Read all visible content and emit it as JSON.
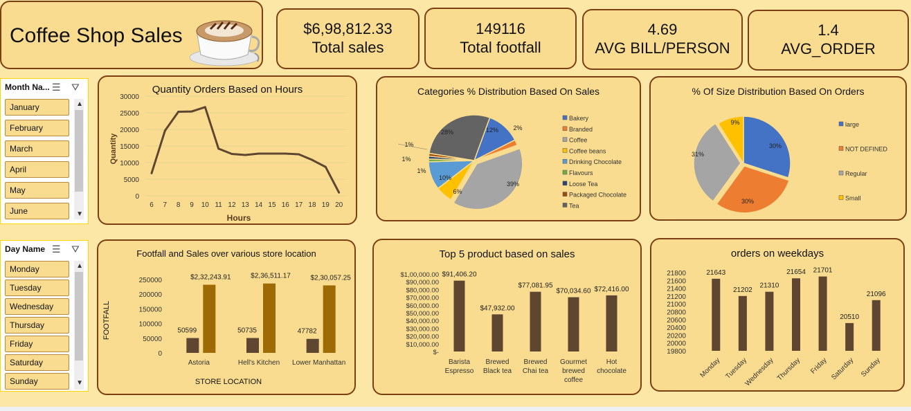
{
  "title": "Coffee Shop Sales",
  "kpis": [
    {
      "value": "$6,98,812.33",
      "label": "Total sales"
    },
    {
      "value": "149116",
      "label": "Total footfall"
    },
    {
      "value": "4.69",
      "label": "AVG BILL/PERSON"
    },
    {
      "value": "1.4",
      "label": "AVG_ORDER"
    }
  ],
  "month_slicer": {
    "header": "Month Na...",
    "items": [
      "January",
      "February",
      "March",
      "April",
      "May",
      "June"
    ]
  },
  "day_slicer": {
    "header": "Day Name",
    "items": [
      "Monday",
      "Tuesday",
      "Wednesday",
      "Thursday",
      "Friday",
      "Saturday",
      "Sunday"
    ]
  },
  "colors": {
    "bar_brown": "#5e4630",
    "bar_gold": "#9e6a05",
    "line": "#5e4630",
    "border": "#7b3f12",
    "card": "#f9dc8f",
    "bg": "#fde7a6"
  },
  "chart_data": [
    {
      "type": "line",
      "title": "Quantity Orders Based on Hours",
      "xlabel": "Hours",
      "ylabel": "Quantity",
      "x": [
        6,
        7,
        8,
        9,
        10,
        11,
        12,
        13,
        14,
        15,
        16,
        17,
        18,
        19,
        20
      ],
      "values": [
        6800,
        19600,
        25300,
        25400,
        26700,
        14200,
        12600,
        12300,
        12700,
        12700,
        12700,
        12500,
        10800,
        8700,
        1000
      ],
      "ylim": [
        0,
        30000
      ],
      "yticks": [
        "0",
        "5000",
        "10000",
        "15000",
        "20000",
        "25000",
        "30000"
      ]
    },
    {
      "type": "pie",
      "title": "Categories % Distribution Based On Sales",
      "labels": [
        "Bakery",
        "Branded",
        "Coffee",
        "Coffee beans",
        "Drinking Chocolate",
        "Flavours",
        "Loose Tea",
        "Packaged Chocolate",
        "Tea"
      ],
      "values": [
        12,
        2,
        39,
        6,
        10,
        1,
        1,
        1,
        28
      ],
      "data_labels": [
        "12%",
        "2%",
        "39%",
        "6%",
        "10%",
        "1%",
        "1%",
        "1%",
        "28%"
      ],
      "colors": [
        "#4472c4",
        "#ed7d31",
        "#a5a5a5",
        "#ffc000",
        "#5b9bd5",
        "#70ad47",
        "#264478",
        "#9e480e",
        "#636363"
      ],
      "legend": "right"
    },
    {
      "type": "pie",
      "title": "% Of Size Distribution Based On Orders",
      "labels": [
        "large",
        "NOT DEFINED",
        "Regular",
        "Small"
      ],
      "values": [
        30,
        30,
        31,
        9
      ],
      "data_labels": [
        "30%",
        "30%",
        "31%",
        "9%"
      ],
      "colors": [
        "#4472c4",
        "#ed7d31",
        "#a5a5a5",
        "#ffc000"
      ],
      "legend": "right"
    },
    {
      "type": "bar",
      "title": "Footfall and Sales over various store location",
      "xlabel": "STORE LOCATION",
      "ylabel": "FOOTFALL",
      "categories": [
        "Astoria",
        "Hell's Kitchen",
        "Lower Manhattan"
      ],
      "series": [
        {
          "values": [
            50599,
            50735,
            47782
          ],
          "labels": [
            "50599",
            "50735",
            "47782"
          ]
        },
        {
          "values": [
            232243.91,
            236511.17,
            230057.25
          ],
          "labels": [
            "$2,32,243.91",
            "$2,36,511.17",
            "$2,30,057.25"
          ]
        }
      ],
      "ylim": [
        0,
        250000
      ],
      "yticks": [
        "0",
        "50000",
        "100000",
        "150000",
        "200000",
        "250000"
      ]
    },
    {
      "type": "bar",
      "title": "Top 5 product based on sales",
      "categories": [
        [
          "Barista",
          "Espresso"
        ],
        [
          "Brewed",
          "Black tea"
        ],
        [
          "Brewed",
          "Chai tea"
        ],
        [
          "Gourmet",
          "brewed",
          "coffee"
        ],
        [
          "Hot",
          "chocolate"
        ]
      ],
      "values": [
        91406.2,
        47932.0,
        77081.95,
        70034.6,
        72416.0
      ],
      "data_labels": [
        "$91,406.20",
        "$47,932.00",
        "$77,081.95",
        "$70,034.60",
        "$72,416.00"
      ],
      "ylim": [
        0,
        100000
      ],
      "yticks": [
        "$-",
        "$10,000.00",
        "$20,000.00",
        "$30,000.00",
        "$40,000.00",
        "$50,000.00",
        "$60,000.00",
        "$70,000.00",
        "$80,000.00",
        "$90,000.00",
        "$1,00,000.00"
      ]
    },
    {
      "type": "bar",
      "title": "orders on weekdays",
      "categories": [
        "Monday",
        "Tuesday",
        "Wednesday",
        "Thursday",
        "Friday",
        "Saturday",
        "Sunday"
      ],
      "values": [
        21643,
        21202,
        21310,
        21654,
        21701,
        20510,
        21096
      ],
      "data_labels": [
        "21643",
        "21202",
        "21310",
        "21654",
        "21701",
        "20510",
        "21096"
      ],
      "ylim": [
        19800,
        21800
      ],
      "yticks": [
        "19800",
        "20000",
        "20200",
        "20400",
        "20600",
        "20800",
        "21000",
        "21200",
        "21400",
        "21600",
        "21800"
      ]
    }
  ]
}
